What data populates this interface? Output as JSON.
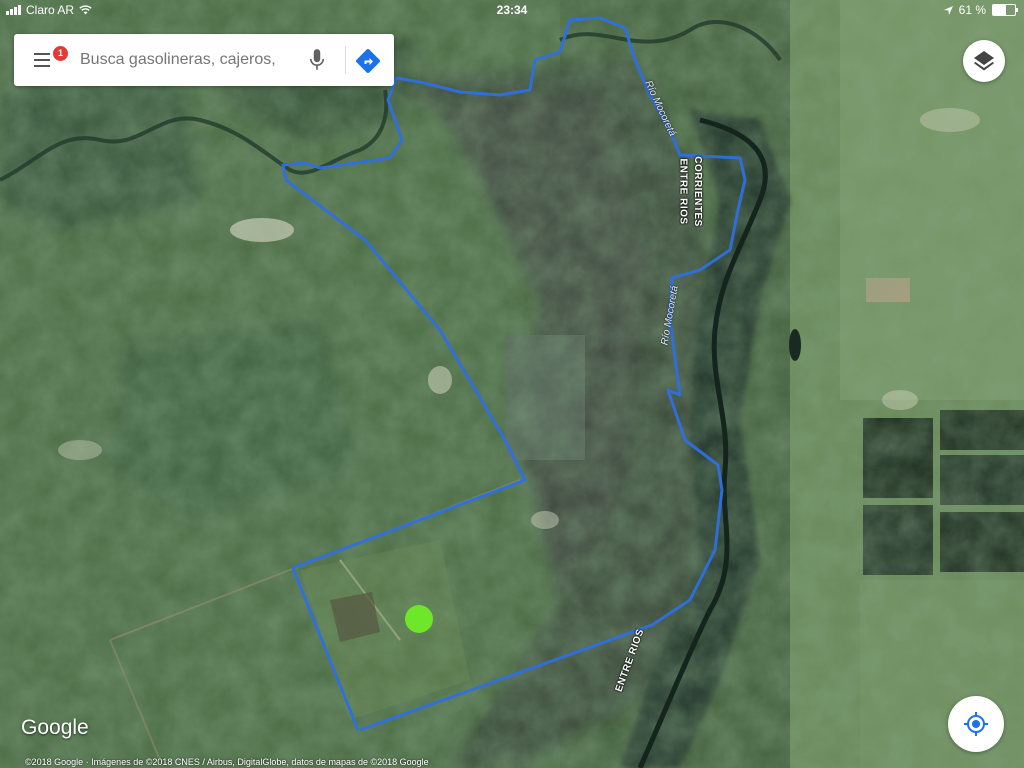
{
  "status_bar": {
    "carrier": "Claro AR",
    "time": "23:34",
    "battery_percent": "61 %",
    "battery_level": 0.61
  },
  "search": {
    "placeholder": "Busca gasolineras, cajeros,",
    "notification_count": "1",
    "menu_icon": "hamburger-menu-icon",
    "mic_icon": "microphone-icon",
    "directions_icon": "directions-icon"
  },
  "map": {
    "type": "satellite",
    "route_color": "#2f6fe0",
    "marker_color": "#6ee62a",
    "labels": {
      "corrientes": "CORRIENTES",
      "entre_rios_top": "ENTRE RIOS",
      "entre_rios_bottom": "ENTRE RIOS",
      "rio_mocoreta_top": "Río Mocoretá",
      "rio_mocoreta_mid": "Río Mocoretá"
    }
  },
  "controls": {
    "layers_icon": "layers-icon",
    "locate_icon": "my-location-icon"
  },
  "branding": {
    "logo": "Google",
    "copyright": "©2018 Google · Imágenes de ©2018 CNES / Airbus, DigitalGlobe, datos de mapas de ©2018 Google"
  }
}
